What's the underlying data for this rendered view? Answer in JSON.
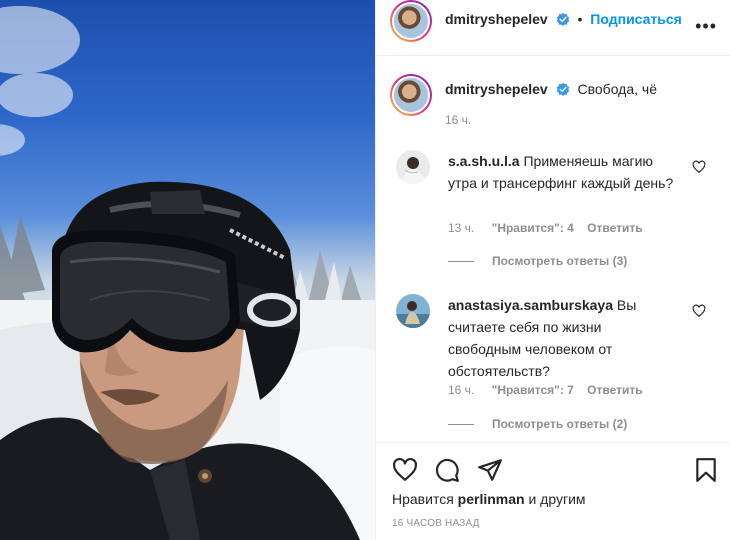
{
  "post": {
    "author": "dmitryshepelev",
    "follow_label": "Подписаться",
    "more_label": "•••",
    "caption": "Свобода, чё",
    "caption_age": "16 ч."
  },
  "comments": [
    {
      "user": "s.a.sh.u.l.a",
      "text": "Применяешь магию утра и трансерфинг каждый день?",
      "age": "13 ч.",
      "likes_text": "\"Нравится\": 4",
      "reply_label": "Ответить",
      "view_replies": "Посмотреть ответы (3)"
    },
    {
      "user": "anastasiya.samburskaya",
      "text": "Вы считаете себя по жизни свободным человеком от обстоятельств?",
      "age": "16 ч.",
      "likes_text": "\"Нравится\": 7",
      "reply_label": "Ответить",
      "view_replies": "Посмотреть ответы (2)"
    }
  ],
  "footer": {
    "likes_prefix": "Нравится",
    "likes_user": "perlinman",
    "likes_suffix": "и другим",
    "time_ago": "16 ЧАСОВ НАЗАД"
  },
  "icons": {
    "verified": "verified-badge-icon",
    "like": "heart-icon",
    "comment": "comment-bubble-icon",
    "share": "paper-plane-icon",
    "save": "bookmark-icon",
    "more": "more-options-icon"
  },
  "colors": {
    "accent": "#0095f6",
    "text": "#262626",
    "muted": "#8e8e8e",
    "divider": "#efefef"
  }
}
